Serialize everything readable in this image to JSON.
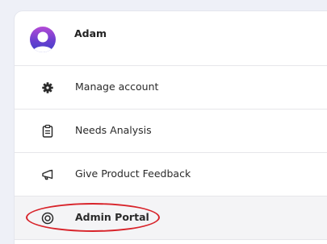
{
  "user": {
    "name": "Adam",
    "avatar_icon": "user-avatar-icon"
  },
  "menu": {
    "items": [
      {
        "label": "Manage account",
        "icon": "gear-icon"
      },
      {
        "label": "Needs Analysis",
        "icon": "clipboard-icon"
      },
      {
        "label": "Give Product Feedback",
        "icon": "megaphone-icon"
      },
      {
        "label": "Admin Portal",
        "icon": "target-icon"
      }
    ]
  },
  "colors": {
    "annotation_outline": "#d8232a",
    "avatar_gradient": [
      "#b44bd6",
      "#6a3fd0",
      "#3f42c8"
    ]
  }
}
